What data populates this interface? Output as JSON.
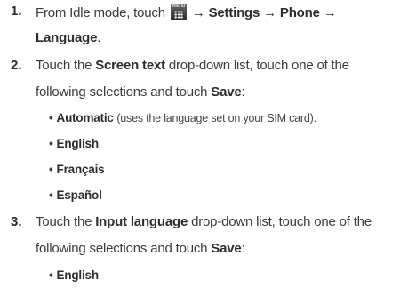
{
  "steps": [
    {
      "number": "1.",
      "line1_pre": "From Idle mode, touch",
      "menu_icon_label": "Menu",
      "line1_path": "→ Settings → Phone →",
      "line2_bold": "Language",
      "line2_end": "."
    },
    {
      "number": "2.",
      "line1_pre": "Touch the",
      "line1_bold": "Screen text",
      "line1_post": "drop-down list, touch one of the",
      "line2_pre": "following selections and touch",
      "line2_bold": "Save",
      "line2_end": ":",
      "options": [
        {
          "label": "Automatic",
          "note": "(uses the language set on your SIM card)."
        },
        {
          "label": "English"
        },
        {
          "label": "Français"
        },
        {
          "label": "Español"
        }
      ]
    },
    {
      "number": "3.",
      "line1_pre": "Touch the",
      "line1_bold": "Input language",
      "line1_post": "drop-down list, touch one of the",
      "line2_pre": "following selections and touch",
      "line2_bold": "Save",
      "line2_end": ":",
      "options": [
        {
          "label": "English"
        }
      ]
    }
  ],
  "icons": {
    "menu": "menu-grid-icon",
    "bullet": "bullet-dot"
  }
}
